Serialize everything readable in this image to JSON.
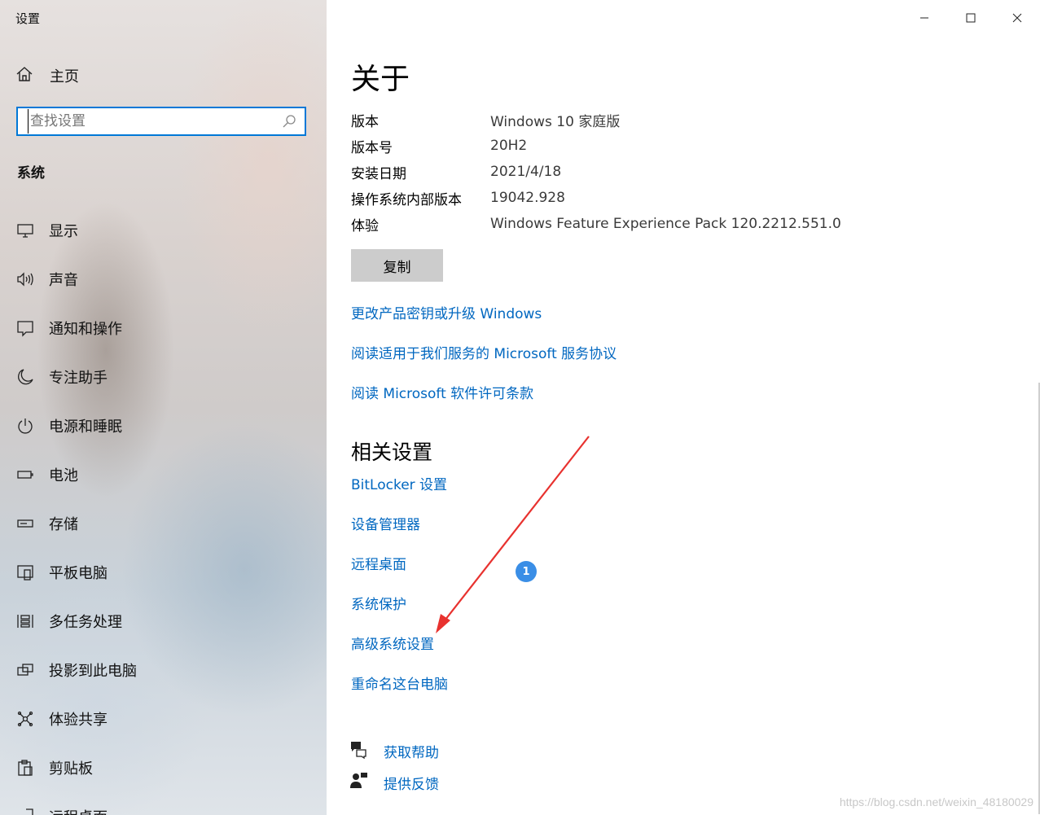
{
  "window": {
    "title": "设置"
  },
  "sidebar": {
    "home_label": "主页",
    "search_placeholder": "查找设置",
    "section_label": "系统",
    "items": [
      {
        "label": "显示",
        "icon": "display-icon"
      },
      {
        "label": "声音",
        "icon": "speaker-icon"
      },
      {
        "label": "通知和操作",
        "icon": "notification-icon"
      },
      {
        "label": "专注助手",
        "icon": "moon-icon"
      },
      {
        "label": "电源和睡眠",
        "icon": "power-icon"
      },
      {
        "label": "电池",
        "icon": "battery-icon"
      },
      {
        "label": "存储",
        "icon": "storage-icon"
      },
      {
        "label": "平板电脑",
        "icon": "tablet-icon"
      },
      {
        "label": "多任务处理",
        "icon": "multitask-icon"
      },
      {
        "label": "投影到此电脑",
        "icon": "project-icon"
      },
      {
        "label": "体验共享",
        "icon": "share-icon"
      },
      {
        "label": "剪贴板",
        "icon": "clipboard-icon"
      },
      {
        "label": "远程桌面",
        "icon": "remote-desktop-icon"
      }
    ]
  },
  "main": {
    "title": "关于",
    "specs": [
      {
        "key": "版本",
        "value": "Windows 10 家庭版"
      },
      {
        "key": "版本号",
        "value": "20H2"
      },
      {
        "key": "安装日期",
        "value": "2021/4/18"
      },
      {
        "key": "操作系统内部版本",
        "value": "19042.928"
      },
      {
        "key": "体验",
        "value": "Windows Feature Experience Pack 120.2212.551.0"
      }
    ],
    "copy_label": "复制",
    "links": [
      "更改产品密钥或升级 Windows",
      "阅读适用于我们服务的 Microsoft 服务协议",
      "阅读 Microsoft 软件许可条款"
    ],
    "related_title": "相关设置",
    "related_links": [
      "BitLocker 设置",
      "设备管理器",
      "远程桌面",
      "系统保护",
      "高级系统设置",
      "重命名这台电脑"
    ],
    "help_label": "获取帮助",
    "feedback_label": "提供反馈",
    "annotation_badge": "1"
  },
  "watermark": "https://blog.csdn.net/weixin_48180029",
  "colors": {
    "accent": "#0078d7",
    "link": "#0067c0",
    "annotation_arrow": "#e8322f",
    "badge": "#3a8ee6"
  }
}
